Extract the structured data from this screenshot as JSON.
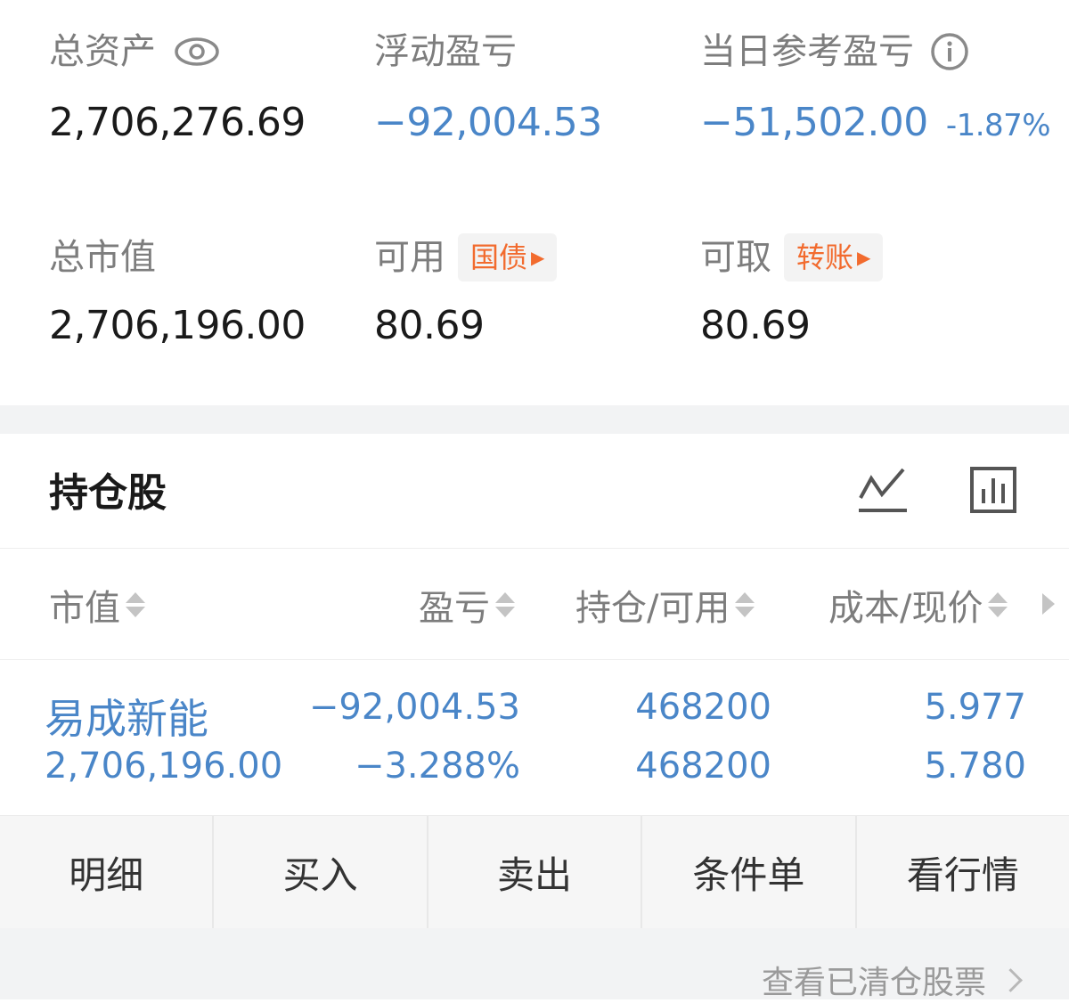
{
  "summary": {
    "total_assets_label": "总资产",
    "total_assets_value": "2,706,276.69",
    "floating_pl_label": "浮动盈亏",
    "floating_pl_value": "−92,004.53",
    "daily_pl_label": "当日参考盈亏",
    "daily_pl_value": "−51,502.00",
    "daily_pl_pct": "-1.87%",
    "market_value_label": "总市值",
    "market_value_value": "2,706,196.00",
    "available_label": "可用",
    "available_tag": "国债",
    "available_value": "80.69",
    "withdrawable_label": "可取",
    "withdrawable_tag": "转账",
    "withdrawable_value": "80.69"
  },
  "positions": {
    "title": "持仓股",
    "columns": [
      "市值",
      "盈亏",
      "持仓/可用",
      "成本/现价"
    ],
    "rows": [
      {
        "name": "易成新能",
        "market_value": "2,706,196.00",
        "pl": "−92,004.53",
        "pl_pct": "−3.288%",
        "holding": "468200",
        "available": "468200",
        "cost": "5.977",
        "price": "5.780"
      }
    ]
  },
  "actions": [
    "明细",
    "买入",
    "卖出",
    "条件单",
    "看行情"
  ],
  "footer": {
    "cleared_link": "查看已清仓股票"
  },
  "colors": {
    "blue": "#4a86c8",
    "tag_orange": "#f26b2e",
    "label_gray": "#7d7d7d"
  }
}
